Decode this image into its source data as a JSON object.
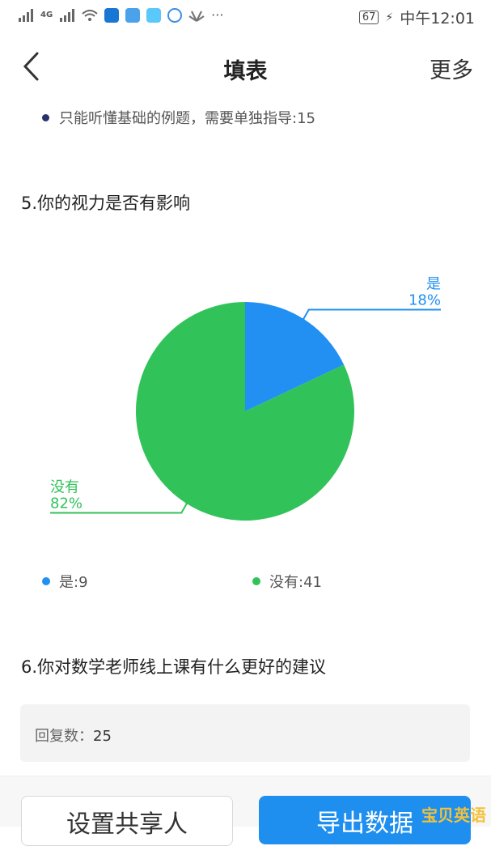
{
  "status_bar": {
    "left_text": "4G",
    "battery": "67",
    "time": "中午12:01",
    "more_glyph": "···"
  },
  "header": {
    "title": "填表",
    "more_label": "更多"
  },
  "q4_option": {
    "text": "只能听懂基础的例题，需要单独指导:15"
  },
  "q5": {
    "question": "5.你的视力是否有影响"
  },
  "chart_data": {
    "type": "pie",
    "slices": [
      {
        "label": "是",
        "value": 9,
        "percent": "18%",
        "color": "#2190f2"
      },
      {
        "label": "没有",
        "value": 41,
        "percent": "82%",
        "color": "#31c35a"
      }
    ],
    "legend": [
      {
        "text": "是:9",
        "color": "#2190f2"
      },
      {
        "text": "没有:41",
        "color": "#31c35a"
      }
    ],
    "legend_placement": "bottom"
  },
  "q6": {
    "question": "6.你对数学老师线上课有什么更好的建议",
    "reply_label": "回复数：",
    "reply_count": "25"
  },
  "bottom": {
    "share_label": "设置共享人",
    "export_label": "导出数据"
  },
  "watermark": "宝贝英语",
  "colors": {
    "accent": "#1e8fef",
    "yes": "#2190f2",
    "no": "#31c35a"
  }
}
